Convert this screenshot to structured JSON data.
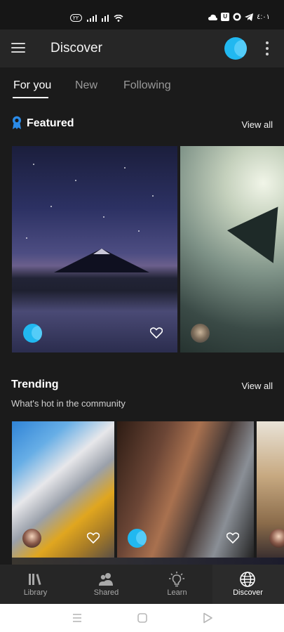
{
  "status_bar": {
    "pill_text": "٢٢",
    "time": "٤:٠١",
    "icons": [
      "cloud-icon",
      "box-icon",
      "whatsapp-icon",
      "telegram-icon",
      "signal-icon",
      "wifi-icon"
    ]
  },
  "app_bar": {
    "title": "Discover",
    "menu_icon": "hamburger-icon",
    "more_icon": "kebab-menu-icon",
    "accent": "#21b8f0"
  },
  "tabs": [
    {
      "label": "For you",
      "active": true
    },
    {
      "label": "New",
      "active": false
    },
    {
      "label": "Following",
      "active": false
    }
  ],
  "featured": {
    "title": "Featured",
    "view_all": "View all",
    "cards": [
      {
        "image": "night-mountain-reflection",
        "avatar": "blue-circle-avatar",
        "liked": false
      },
      {
        "image": "underwater-diver-manta-ray",
        "avatar": "dog-avatar",
        "liked": false
      }
    ]
  },
  "trending": {
    "title": "Trending",
    "view_all": "View all",
    "subtitle": "What's hot in the community",
    "cards": [
      {
        "image": "airplane-engine-stop-sign",
        "avatar": "person-avatar",
        "liked": false
      },
      {
        "image": "father-and-child-selfie",
        "avatar": "blue-circle-avatar",
        "liked": false
      },
      {
        "image": "desert-landscape-person",
        "avatar": "person-avatar",
        "liked": false
      }
    ]
  },
  "bottom_nav": [
    {
      "label": "Library",
      "icon": "library-icon",
      "active": false
    },
    {
      "label": "Shared",
      "icon": "shared-people-icon",
      "active": false
    },
    {
      "label": "Learn",
      "icon": "lightbulb-icon",
      "active": false
    },
    {
      "label": "Discover",
      "icon": "globe-icon",
      "active": true
    }
  ],
  "system_nav": [
    "menu-icon",
    "home-icon",
    "back-icon"
  ]
}
